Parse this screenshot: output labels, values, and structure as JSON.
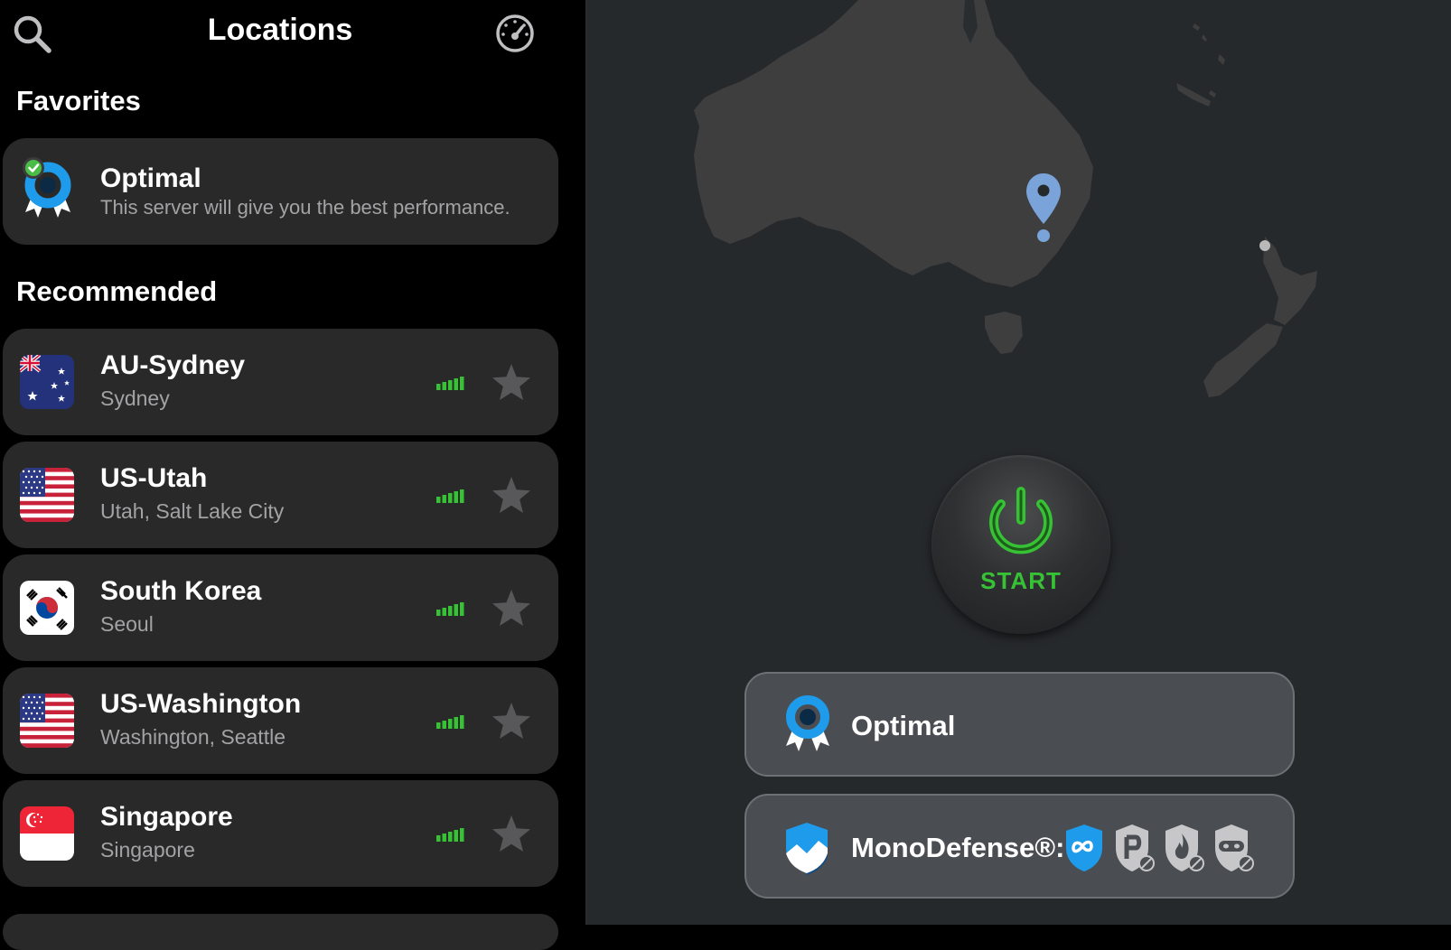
{
  "header": {
    "title": "Locations",
    "search_icon": "search-icon",
    "speedtest_icon": "speedometer-icon"
  },
  "favorites": {
    "title": "Favorites",
    "item": {
      "name": "Optimal",
      "description": "This server will give you the best performance.",
      "icon": "optimal-badge-icon"
    }
  },
  "recommended": {
    "title": "Recommended",
    "items": [
      {
        "name": "AU-Sydney",
        "city": "Sydney",
        "flag": "australia-flag-icon"
      },
      {
        "name": "US-Utah",
        "city": "Utah, Salt Lake City",
        "flag": "usa-flag-icon"
      },
      {
        "name": "South Korea",
        "city": "Seoul",
        "flag": "south-korea-flag-icon"
      },
      {
        "name": "US-Washington",
        "city": "Washington, Seattle",
        "flag": "usa-flag-icon"
      },
      {
        "name": "Singapore",
        "city": "Singapore",
        "flag": "singapore-flag-icon"
      }
    ]
  },
  "main": {
    "start_label": "START",
    "location_button": {
      "label": "Optimal"
    },
    "monodefense": {
      "label": "MonoDefense®:",
      "features": [
        "infinity-shield-icon",
        "parking-blocked-icon",
        "firewall-blocked-icon",
        "mask-blocked-icon"
      ]
    }
  },
  "colors": {
    "accent_green": "#37c135",
    "accent_blue": "#1e9bea",
    "card_bg": "#292929",
    "map_bg": "#26292c",
    "land": "#3e3e3e",
    "pin": "#7aa3d9"
  }
}
